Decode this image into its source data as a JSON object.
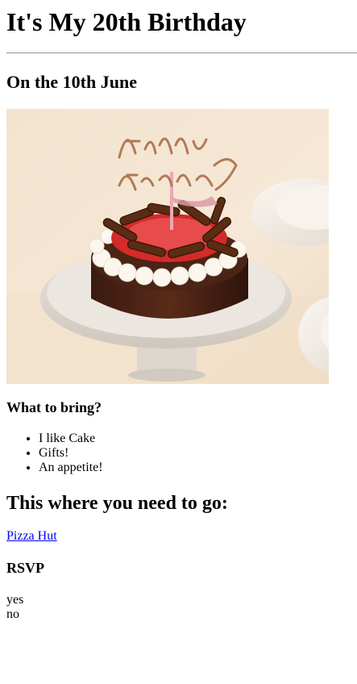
{
  "page": {
    "title": "It's My 20th Birthday",
    "date_heading": "On the 10th June"
  },
  "bring": {
    "heading": "What to bring?",
    "items": [
      "I like Cake",
      "Gifts!",
      "An appetite!"
    ]
  },
  "location": {
    "heading": "This where you need to go:",
    "link_text": "Pizza Hut"
  },
  "rsvp": {
    "heading": "RSVP",
    "options": [
      "yes",
      "no"
    ]
  },
  "image": {
    "topper_text": "Happy Birthday"
  }
}
